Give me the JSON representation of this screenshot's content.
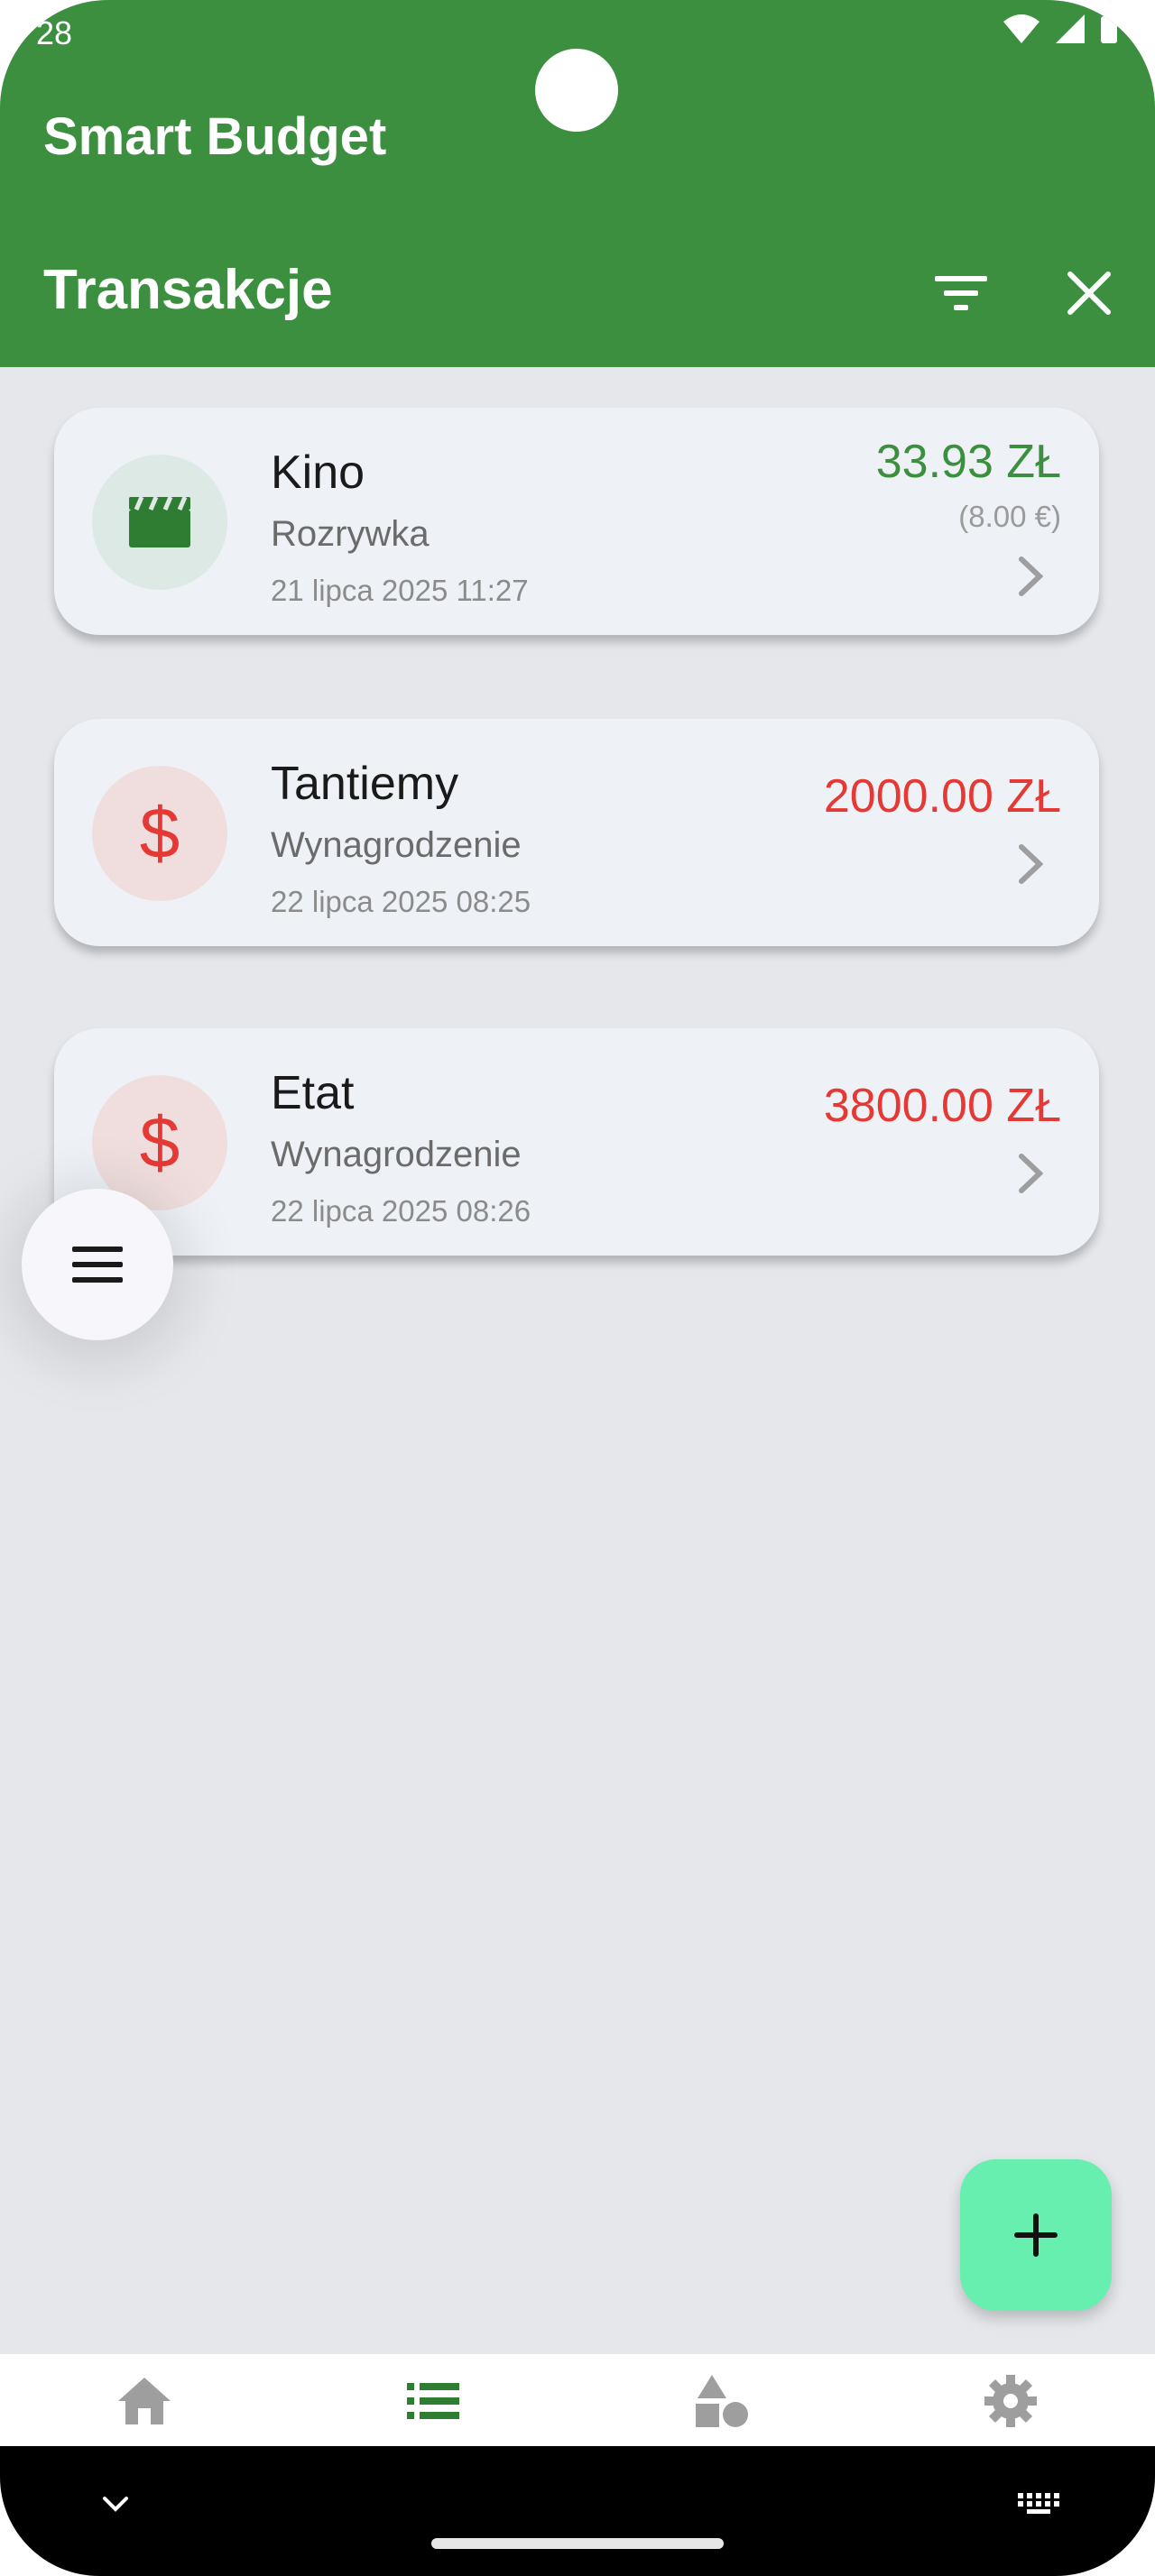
{
  "status_bar": {
    "time": "28"
  },
  "app": {
    "title": "Smart Budget"
  },
  "screen": {
    "title": "Transakcje"
  },
  "transactions": [
    {
      "name": "Kino",
      "category": "Rozrywka",
      "date": "21 lipca 2025 11:27",
      "amount": "33.93 ZŁ",
      "secondary_amount": "(8.00 €)",
      "amount_color": "#3b8f3f",
      "icon": "movie-clapper-icon"
    },
    {
      "name": "Tantiemy",
      "category": "Wynagrodzenie",
      "date": "22 lipca 2025 08:25",
      "amount": "2000.00 ZŁ",
      "amount_color": "#e53935",
      "icon": "dollar-icon"
    },
    {
      "name": "Etat",
      "category": "Wynagrodzenie",
      "date": "22 lipca 2025 08:26",
      "amount": "3800.00 ZŁ",
      "amount_color": "#e53935",
      "icon": "dollar-icon"
    }
  ],
  "colors": {
    "appbar": "#3b8f3f",
    "expense": "#e53935",
    "income": "#3b8f3f",
    "fab": "#67efb0"
  },
  "bottom_nav": {
    "items": [
      "home-icon",
      "list-icon",
      "categories-icon",
      "settings-icon"
    ],
    "active": "list-icon"
  }
}
